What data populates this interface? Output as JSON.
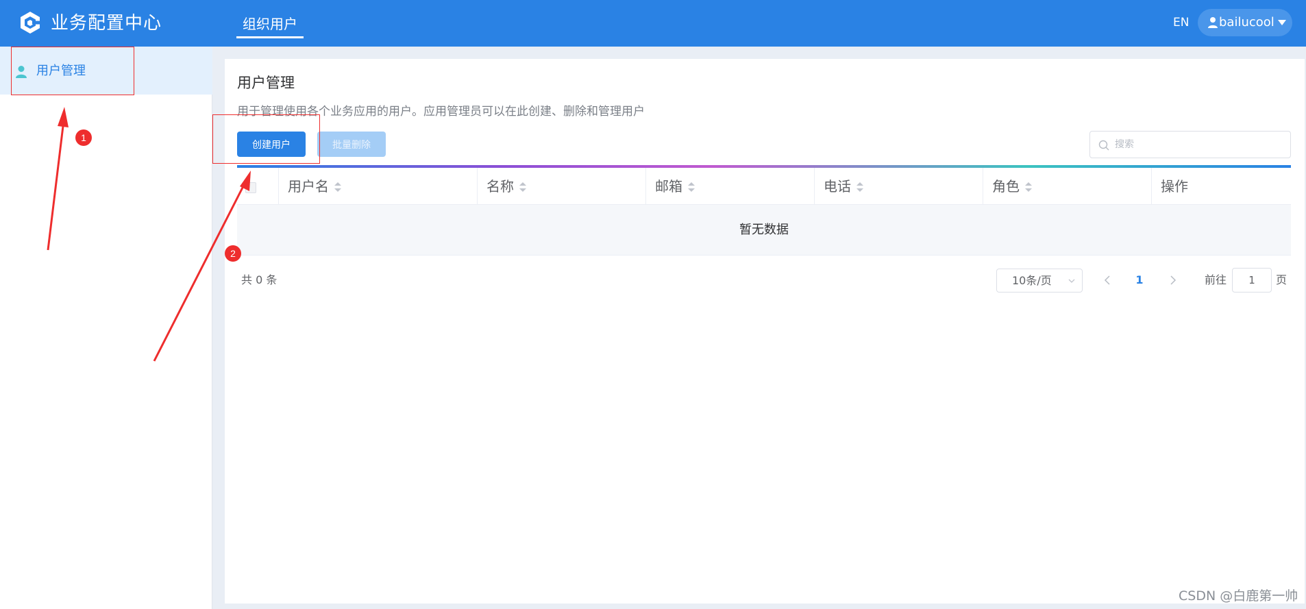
{
  "header": {
    "app_title": "业务配置中心",
    "nav_tab": "组织用户",
    "lang": "EN",
    "username": "bailucool"
  },
  "sidebar": {
    "items": [
      {
        "label": "用户管理",
        "icon": "user-icon",
        "active": true
      }
    ]
  },
  "page": {
    "title": "用户管理",
    "description": "用于管理使用各个业务应用的用户。应用管理员可以在此创建、删除和管理用户",
    "create_button": "创建用户",
    "bulk_delete_button": "批量删除",
    "search_placeholder": "搜索"
  },
  "table": {
    "columns": [
      {
        "label": "用户名",
        "sortable": true
      },
      {
        "label": "名称",
        "sortable": true
      },
      {
        "label": "邮箱",
        "sortable": true
      },
      {
        "label": "电话",
        "sortable": true
      },
      {
        "label": "角色",
        "sortable": true
      },
      {
        "label": "操作",
        "sortable": false
      }
    ],
    "rows": [],
    "empty_text": "暂无数据"
  },
  "pagination": {
    "total_text": "共 0 条",
    "page_size": "10条/页",
    "current_page": "1",
    "goto_label": "前往",
    "goto_value": "1",
    "goto_suffix": "页"
  },
  "annotations": {
    "badges": [
      "1",
      "2"
    ],
    "color": "#ee2d2d"
  },
  "watermark": "CSDN @白鹿第一帅",
  "colors": {
    "primary": "#2a82e4",
    "sidebar_active_bg": "#e3f0fd",
    "disabled_button": "#a4cdf6",
    "annotation": "#ee2d2d"
  }
}
